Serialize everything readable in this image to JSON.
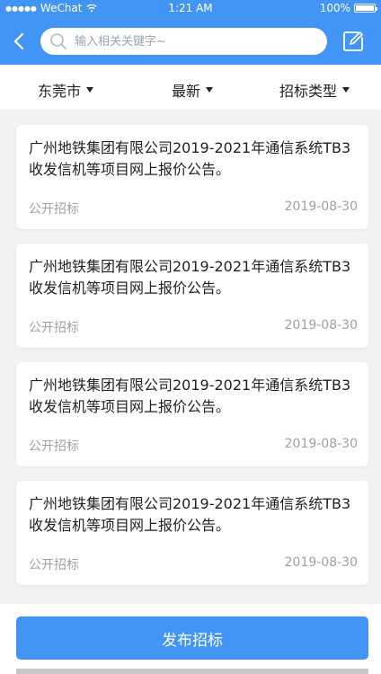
{
  "status_bar": {
    "carrier": "WeChat",
    "time": "1:21 AM",
    "battery": "100%"
  },
  "search": {
    "placeholder": "输入相关关键字~"
  },
  "filters": [
    {
      "label": "东莞市"
    },
    {
      "label": "最新"
    },
    {
      "label": "招标类型"
    }
  ],
  "items": [
    {
      "title": "广州地铁集团有限公司2019-2021年通信系统TB3收发信机等项目网上报价公告。",
      "type": "公开招标",
      "date": "2019-08-30"
    },
    {
      "title": "广州地铁集团有限公司2019-2021年通信系统TB3收发信机等项目网上报价公告。",
      "type": "公开招标",
      "date": "2019-08-30"
    },
    {
      "title": "广州地铁集团有限公司2019-2021年通信系统TB3收发信机等项目网上报价公告。",
      "type": "公开招标",
      "date": "2019-08-30"
    },
    {
      "title": "广州地铁集团有限公司2019-2021年通信系统TB3收发信机等项目网上报价公告。",
      "type": "公开招标",
      "date": "2019-08-30"
    }
  ],
  "publish_button": {
    "label": "发布招标"
  },
  "icons": {
    "back": "back-chevron-icon",
    "search": "search-icon",
    "edit": "edit-icon"
  },
  "colors": {
    "accent": "#4395f5",
    "text": "#222222",
    "muted": "#a1a1a1",
    "background": "#f2f2f2"
  }
}
